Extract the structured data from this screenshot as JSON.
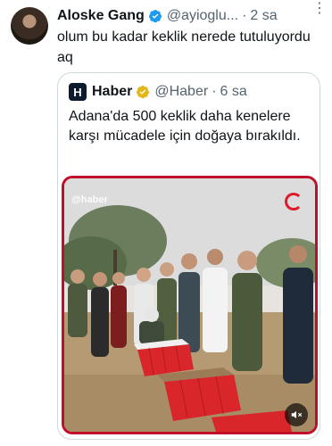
{
  "tweet": {
    "author_name": "Aloske Gang",
    "author_handle": "@ayioglu...",
    "separator": "·",
    "time": "2 sa",
    "more_glyph": "⋮",
    "text": "olum bu kadar keklik nerede tutuluyordu aq"
  },
  "quote": {
    "logo_letter": "H",
    "author_name": "Haber",
    "author_handle": "@Haber",
    "separator": "·",
    "time": "6 sa",
    "text": "Adana'da 500 keklik daha kenelere karşı mücadele için doğaya bırakıldı.",
    "media": {
      "watermark": "@haber",
      "mute_icon": "speaker-muted-icon"
    }
  },
  "colors": {
    "verified": "#1d9bf0",
    "gold_verified": "#e2b719",
    "media_border": "#c00d2a",
    "crate": "#d8262b"
  }
}
